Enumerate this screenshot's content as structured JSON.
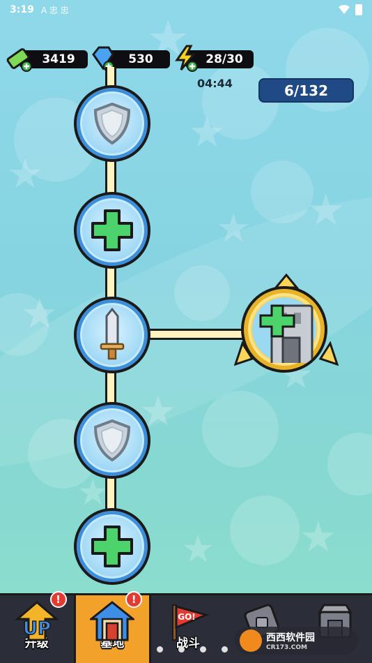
{
  "status_bar": {
    "time": "3:19",
    "notification_glyphs": "A 忠 忠"
  },
  "resources": {
    "cash": "3419",
    "gems": "530",
    "energy": "28/30"
  },
  "timer": "04:44",
  "stage_progress": "6/132",
  "skill_tree": {
    "nodes": [
      {
        "icon": "shield-icon"
      },
      {
        "icon": "heal-cross-icon"
      },
      {
        "icon": "sword-icon"
      },
      {
        "icon": "shield-icon"
      },
      {
        "icon": "heal-cross-icon"
      }
    ],
    "branch_node": {
      "icon": "heal-building-icon",
      "style": "gold"
    }
  },
  "tabs": [
    {
      "label": "升级",
      "alert": "!",
      "icon": "up-arrow-icon"
    },
    {
      "label": "基地",
      "alert": "!",
      "icon": "house-icon",
      "active": true
    },
    {
      "label": "战斗",
      "icon": "go-flag-icon",
      "badge": "GO!"
    },
    {
      "label": "",
      "icon": "locked-icon"
    },
    {
      "label": "",
      "icon": "locked-shop-icon"
    }
  ],
  "watermark": {
    "text": "西西软件园",
    "sub": "CR173.COM"
  },
  "colors": {
    "active_tab": "#f2a12b",
    "progress_pill": "#1f4a86",
    "track": "#fff3c2",
    "gold_node": "#fbd45a"
  }
}
